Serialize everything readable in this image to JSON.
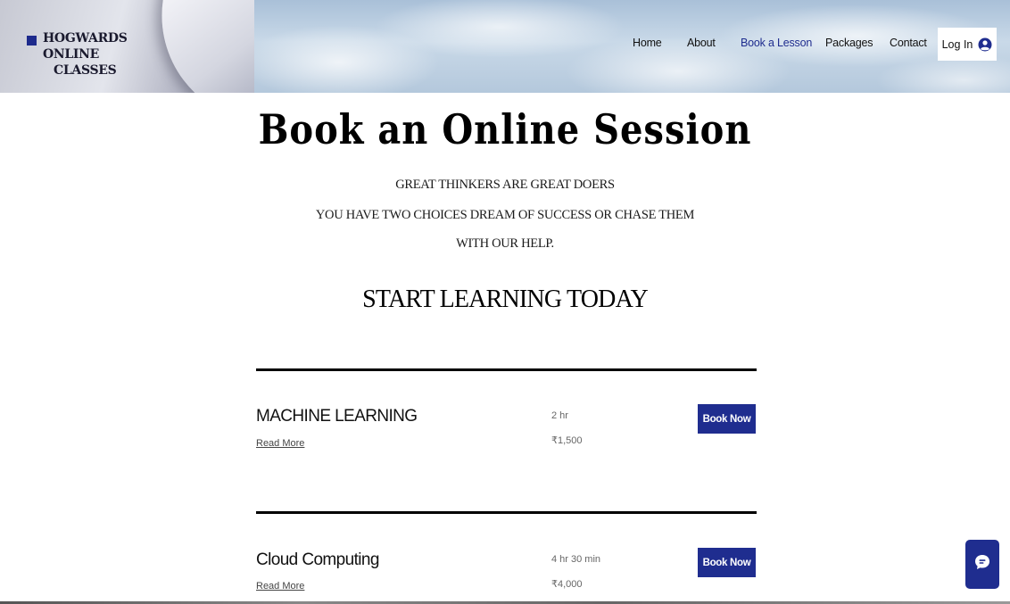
{
  "brand": {
    "name_line1": "HOGWARDS ONLINE",
    "name_line2": "CLASSES",
    "accent_color": "#1f2d8f"
  },
  "nav": {
    "items": [
      {
        "label": "Home",
        "active": false
      },
      {
        "label": "About",
        "active": false
      },
      {
        "label": "Book a Lesson",
        "active": true
      },
      {
        "label": "Packages",
        "active": false
      },
      {
        "label": "Contact",
        "active": false
      }
    ],
    "login_label": "Log In",
    "login_icon": "user-circle-icon"
  },
  "hero": {
    "title": "Book an Online Session",
    "tagline_lines": [
      "GREAT THINKERS ARE GREAT DOERS",
      "YOU HAVE TWO CHOICES DREAM OF SUCCESS OR CHASE THEM",
      "WITH OUR HELP."
    ],
    "section_title": "START LEARNING TODAY"
  },
  "services": [
    {
      "name": "MACHINE LEARNING",
      "read_more": "Read More",
      "duration": "2 hr",
      "price": "₹1,500",
      "button_label": "Book Now"
    },
    {
      "name": "Cloud Computing",
      "read_more": "Read More",
      "duration": "4 hr 30 min",
      "price": "₹4,000",
      "button_label": "Book Now"
    }
  ],
  "chat": {
    "icon": "chat-bubble-icon"
  }
}
